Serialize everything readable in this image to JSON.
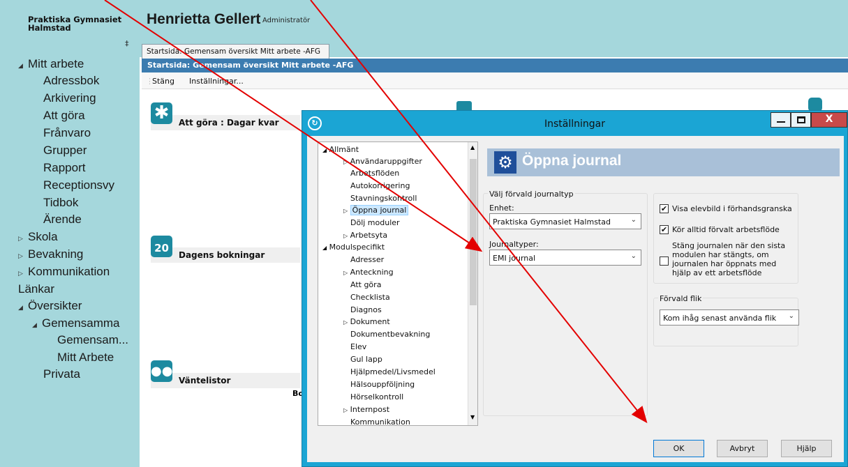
{
  "sidebar": {
    "org_name": "Praktiska Gymnasiet Halmstad",
    "pin_glyph": "‡",
    "items": [
      {
        "label": "Mitt arbete",
        "expander": "◢"
      },
      {
        "label": "Adressbok"
      },
      {
        "label": "Arkivering"
      },
      {
        "label": "Att göra"
      },
      {
        "label": "Frånvaro"
      },
      {
        "label": "Grupper"
      },
      {
        "label": "Rapport"
      },
      {
        "label": "Receptionsvy"
      },
      {
        "label": "Tidbok"
      },
      {
        "label": "Ärende"
      },
      {
        "label": "Skola",
        "expander": "▷"
      },
      {
        "label": "Bevakning",
        "expander": "▷"
      },
      {
        "label": "Kommunikation",
        "expander": "▷"
      },
      {
        "label": "Länkar"
      },
      {
        "label": "Översikter",
        "expander": "◢"
      },
      {
        "label": "Gemensamma",
        "expander": "◢"
      },
      {
        "label": "Gemensam..."
      },
      {
        "label": "Mitt Arbete"
      },
      {
        "label": "Privata"
      }
    ]
  },
  "header": {
    "user_name": "Henrietta Gellert",
    "user_role": "Administratör"
  },
  "tabs": {
    "active_tab": "Startsida: Gemensam översikt Mitt arbete -AFG",
    "panel_title": "Startsida: Gemensam översikt Mitt arbete -AFG"
  },
  "toolbar": {
    "close_label": "Stäng",
    "settings_label": "Inställningar..."
  },
  "widgets": {
    "todo_title": "Att göra : Dagar kvar",
    "bookings_title": "Dagens bokningar",
    "bookings_icon_text": "20",
    "waitlist_title": "Väntelistor",
    "partial_text": "Bo"
  },
  "dialog": {
    "title": "Inställningar",
    "tree": [
      {
        "label": "Allmänt",
        "exp": "◢"
      },
      {
        "label": "Användaruppgifter",
        "exp": "▷"
      },
      {
        "label": "Arbetsflöden"
      },
      {
        "label": "Autokorrigering"
      },
      {
        "label": "Stavningskontroll"
      },
      {
        "label": "Öppna journal",
        "exp": "▷"
      },
      {
        "label": "Dölj moduler"
      },
      {
        "label": "Arbetsyta",
        "exp": "▷"
      },
      {
        "label": "Modulspecifikt",
        "exp": "◢"
      },
      {
        "label": "Adresser"
      },
      {
        "label": "Anteckning",
        "exp": "▷"
      },
      {
        "label": "Att göra"
      },
      {
        "label": "Checklista"
      },
      {
        "label": "Diagnos"
      },
      {
        "label": "Dokument",
        "exp": "▷"
      },
      {
        "label": "Dokumentbevakning"
      },
      {
        "label": "Elev"
      },
      {
        "label": "Gul lapp"
      },
      {
        "label": "Hjälpmedel/Livsmedel"
      },
      {
        "label": "Hälsouppföljning"
      },
      {
        "label": "Hörselkontroll"
      },
      {
        "label": "Internpost",
        "exp": "▷"
      },
      {
        "label": "Kommunikation"
      }
    ],
    "section_title": "Öppna journal",
    "group_default_journal": "Välj förvald journaltyp",
    "unit_label": "Enhet:",
    "unit_value": "Praktiska Gymnasiet Halmstad",
    "journal_types_label": "Journaltyper:",
    "journal_types_value": "EMI journal",
    "cb_show_photo": "Visa elevbild i förhandsgranska",
    "cb_run_workflow": "Kör alltid förvalt arbetsflöde",
    "cb_close_journal": "Stäng journalen när den sista modulen har stängts, om journalen har öppnats med hjälp av ett arbetsflöde",
    "cb_show_photo_checked": true,
    "cb_run_workflow_checked": true,
    "cb_close_journal_checked": false,
    "default_tab_label": "Förvald flik",
    "default_tab_value": "Kom ihåg senast använda flik",
    "ok_label": "OK",
    "cancel_label": "Avbryt",
    "help_label": "Hjälp",
    "check_glyph": "✔"
  },
  "colors": {
    "background": "#a5d7dc",
    "panel_title": "#3c7cb0",
    "dialog_frame": "#1ba5d4",
    "close_button": "#c84a4a",
    "annotation_arrow": "#e30000"
  }
}
